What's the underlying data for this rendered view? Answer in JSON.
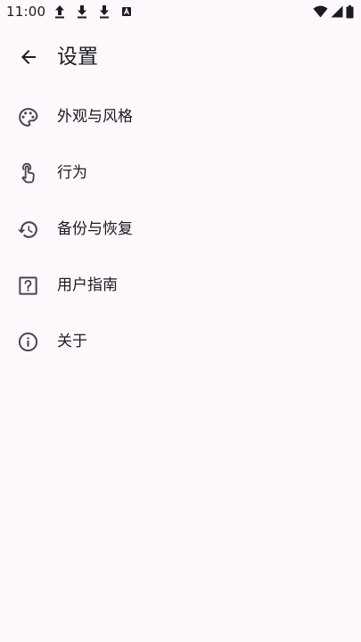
{
  "status_bar": {
    "time": "11:00",
    "left_icons": [
      "upload-arrow-icon",
      "download-arrow-icon",
      "download-arrow-icon",
      "keyboard-a-icon"
    ],
    "right_icons": [
      "wifi-icon",
      "cell-signal-icon",
      "battery-icon"
    ]
  },
  "app_bar": {
    "back_icon": "arrow-back-icon",
    "title": "设置"
  },
  "menu": {
    "items": [
      {
        "label": "外观与风格",
        "icon": "palette-icon"
      },
      {
        "label": "行为",
        "icon": "touch-hand-icon"
      },
      {
        "label": "备份与恢复",
        "icon": "history-restore-icon"
      },
      {
        "label": "用户指南",
        "icon": "help-box-icon"
      },
      {
        "label": "关于",
        "icon": "info-icon"
      }
    ]
  },
  "colors": {
    "background": "#FDF8FC",
    "text": "#1C1B1F",
    "icon": "#49454F"
  }
}
